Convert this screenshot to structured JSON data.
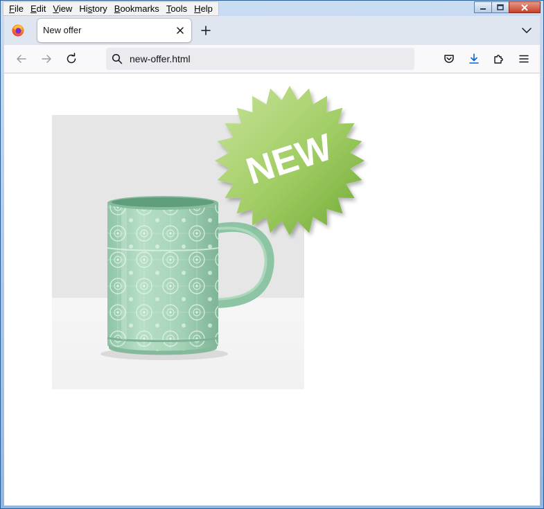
{
  "menubar": {
    "file": {
      "mnemonic": "F",
      "rest": "ile"
    },
    "edit": {
      "mnemonic": "E",
      "rest": "dit"
    },
    "view": {
      "mnemonic": "V",
      "rest": "iew"
    },
    "history": {
      "pre": "Hi",
      "mnemonic": "s",
      "rest": "tory"
    },
    "bookmarks": {
      "mnemonic": "B",
      "rest": "ookmarks"
    },
    "tools": {
      "mnemonic": "T",
      "rest": "ools"
    },
    "help": {
      "mnemonic": "H",
      "rest": "elp"
    }
  },
  "tab": {
    "title": "New offer"
  },
  "urlbar": {
    "url": "new-offer.html"
  },
  "content": {
    "badge_text": "NEW"
  },
  "colors": {
    "badge_light": "#c3e08e",
    "badge_dark": "#79b23a",
    "mug": "#a9d6bb",
    "photo_bg_top": "#e6e6e7",
    "photo_bg_bottom": "#f3f3f3",
    "download_accent": "#0061e0"
  },
  "icons": {
    "app": "firefox-icon",
    "back": "arrow-left-icon",
    "forward": "arrow-right-icon",
    "reload": "reload-icon",
    "search": "search-icon",
    "pocket": "pocket-icon",
    "downloads": "download-icon",
    "extensions": "puzzle-icon",
    "menu": "hamburger-menu-icon"
  }
}
